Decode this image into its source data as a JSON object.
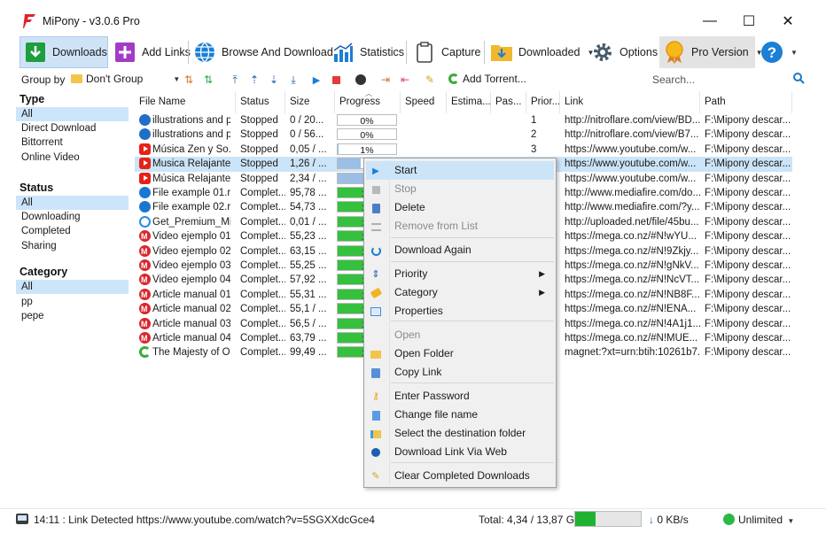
{
  "window": {
    "title": "MiPony - v3.0.6 Pro",
    "controls": {
      "minimize": "—",
      "maximize": "☐",
      "close": "✕"
    }
  },
  "toolbar": {
    "downloads": "Downloads",
    "add_links": "Add Links",
    "browse": "Browse And Download",
    "statistics": "Statistics",
    "capture": "Capture",
    "downloaded": "Downloaded",
    "options": "Options",
    "pro": "Pro Version",
    "help": "?"
  },
  "filter": {
    "group_by_label": "Group by",
    "group_value": "Don't Group",
    "add_torrent": "Add Torrent...",
    "search_placeholder": "Search..."
  },
  "sidebar": {
    "type_heading": "Type",
    "type_items": [
      "All",
      "Direct Download",
      "Bittorrent",
      "Online Video"
    ],
    "status_heading": "Status",
    "status_items": [
      "All",
      "Downloading",
      "Completed",
      "Sharing"
    ],
    "category_heading": "Category",
    "category_items": [
      "All",
      "pp",
      "pepe"
    ]
  },
  "table": {
    "columns": [
      "File Name",
      "Status",
      "Size",
      "Progress",
      "Speed",
      "Estima...",
      "Pas...",
      "Prior...",
      "Link",
      "Path"
    ],
    "rows": [
      {
        "icon": "blue",
        "name": "illustrations and p...",
        "status": "Stopped",
        "size": "0 / 20...",
        "progress": 0,
        "progress_text": "0%",
        "priority": "1",
        "link": "http://nitroflare.com/view/BD...",
        "path": "F:\\Mipony descar..."
      },
      {
        "icon": "blue",
        "name": "illustrations and p...",
        "status": "Stopped",
        "size": "0 / 56...",
        "progress": 0,
        "progress_text": "0%",
        "priority": "2",
        "link": "http://nitroflare.com/view/B7...",
        "path": "F:\\Mipony descar..."
      },
      {
        "icon": "yt",
        "name": "Música Zen y So...",
        "status": "Stopped",
        "size": "0,05 / ...",
        "progress": 1,
        "progress_text": "1%",
        "priority": "3",
        "link": "https://www.youtube.com/w...",
        "path": "F:\\Mipony descar..."
      },
      {
        "icon": "yt",
        "name": "Musica Relajante...",
        "status": "Stopped",
        "size": "1,26 / ...",
        "progress": 40,
        "progress_text": "2",
        "priority": "",
        "link": "https://www.youtube.com/w...",
        "path": "F:\\Mipony descar..."
      },
      {
        "icon": "yt",
        "name": "Música Relajante...",
        "status": "Stopped",
        "size": "2,34 / ...",
        "progress": 45,
        "progress_text": "7",
        "priority": "",
        "link": "https://www.youtube.com/w...",
        "path": "F:\\Mipony descar..."
      },
      {
        "icon": "mf",
        "name": "File example 01.rar",
        "status": "Complet...",
        "size": "95,78 ...",
        "progress": 100,
        "progress_text": "10",
        "priority": "",
        "link": "http://www.mediafire.com/do...",
        "path": "F:\\Mipony descar..."
      },
      {
        "icon": "mf",
        "name": "File example 02.rar",
        "status": "Complet...",
        "size": "54,73 ...",
        "progress": 100,
        "progress_text": "10",
        "priority": "",
        "link": "http://www.mediafire.com/?y...",
        "path": "F:\\Mipony descar..."
      },
      {
        "icon": "ul",
        "name": "Get_Premium_Mi...",
        "status": "Complet...",
        "size": "0,01 / ...",
        "progress": 100,
        "progress_text": "10",
        "priority": "",
        "link": "http://uploaded.net/file/45bu...",
        "path": "F:\\Mipony descar..."
      },
      {
        "icon": "mega",
        "name": "Video ejemplo 01...",
        "status": "Complet...",
        "size": "55,23 ...",
        "progress": 100,
        "progress_text": "10",
        "priority": "",
        "link": "https://mega.co.nz/#N!wYU...",
        "path": "F:\\Mipony descar..."
      },
      {
        "icon": "mega",
        "name": "Video ejemplo 02...",
        "status": "Complet...",
        "size": "63,15 ...",
        "progress": 100,
        "progress_text": "10",
        "priority": "",
        "link": "https://mega.co.nz/#N!9Zkjy...",
        "path": "F:\\Mipony descar..."
      },
      {
        "icon": "mega",
        "name": "Video ejemplo 03...",
        "status": "Complet...",
        "size": "55,25 ...",
        "progress": 100,
        "progress_text": "10",
        "priority": "",
        "link": "https://mega.co.nz/#N!gNkV...",
        "path": "F:\\Mipony descar..."
      },
      {
        "icon": "mega",
        "name": "Video ejemplo 04...",
        "status": "Complet...",
        "size": "57,92 ...",
        "progress": 100,
        "progress_text": "10",
        "priority": "",
        "link": "https://mega.co.nz/#N!NcVT...",
        "path": "F:\\Mipony descar..."
      },
      {
        "icon": "mega",
        "name": "Article manual 01...",
        "status": "Complet...",
        "size": "55,31 ...",
        "progress": 100,
        "progress_text": "10",
        "priority": "",
        "link": "https://mega.co.nz/#N!NB8F...",
        "path": "F:\\Mipony descar..."
      },
      {
        "icon": "mega",
        "name": "Article manual 02...",
        "status": "Complet...",
        "size": "55,1 / ...",
        "progress": 100,
        "progress_text": "10",
        "priority": "",
        "link": "https://mega.co.nz/#N!ENA...",
        "path": "F:\\Mipony descar..."
      },
      {
        "icon": "mega",
        "name": "Article manual 03...",
        "status": "Complet...",
        "size": "56,5 / ...",
        "progress": 100,
        "progress_text": "10",
        "priority": "",
        "link": "https://mega.co.nz/#N!4A1j1...",
        "path": "F:\\Mipony descar..."
      },
      {
        "icon": "mega",
        "name": "Article manual 04...",
        "status": "Complet...",
        "size": "63,79 ...",
        "progress": 100,
        "progress_text": "10",
        "priority": "",
        "link": "https://mega.co.nz/#N!MUE...",
        "path": "F:\\Mipony descar..."
      },
      {
        "icon": "torr",
        "name": "The Majesty of O...",
        "status": "Complet...",
        "size": "99,49 ...",
        "progress": 100,
        "progress_text": "10",
        "priority": "",
        "link": "magnet:?xt=urn:btih:10261b7...",
        "path": "F:\\Mipony descar..."
      }
    ]
  },
  "context_menu": {
    "items": [
      {
        "label": "Start",
        "icon": "play-icon",
        "disabled": false
      },
      {
        "label": "Stop",
        "icon": "stop-icon",
        "disabled": true
      },
      {
        "label": "Delete",
        "icon": "trash-icon",
        "disabled": false
      },
      {
        "label": "Remove from List",
        "icon": "list-remove-icon",
        "disabled": true
      },
      {
        "label": "Download Again",
        "icon": "refresh-icon",
        "disabled": false
      },
      {
        "label": "Priority",
        "icon": "priority-icon",
        "disabled": false
      },
      {
        "label": "Category",
        "icon": "tag-icon",
        "disabled": false
      },
      {
        "label": "Properties",
        "icon": "properties-icon",
        "disabled": false
      },
      {
        "label": "Open",
        "icon": "",
        "disabled": true
      },
      {
        "label": "Open Folder",
        "icon": "folder-icon",
        "disabled": false
      },
      {
        "label": "Copy Link",
        "icon": "copy-icon",
        "disabled": false
      },
      {
        "label": "Enter Password",
        "icon": "key-icon",
        "disabled": false
      },
      {
        "label": "Change file name",
        "icon": "rename-icon",
        "disabled": false
      },
      {
        "label": "Select the destination folder",
        "icon": "folder-open-icon",
        "disabled": false
      },
      {
        "label": "Download Link Via Web",
        "icon": "info-icon",
        "disabled": false
      },
      {
        "label": "Clear Completed Downloads",
        "icon": "broom-icon",
        "disabled": false
      }
    ]
  },
  "statusbar": {
    "message": "14:11 : Link Detected https://www.youtube.com/watch?v=5SGXXdcGce4",
    "total": "Total: 4,34 / 13,87 GB",
    "total_fraction": 0.31,
    "speed": "0 KB/s",
    "limit": "Unlimited"
  },
  "colors": {
    "selection": "#cce4f7",
    "progress_complete": "#35c13d",
    "progress_partial": "#9bbfe6",
    "mega_red": "#d9272e",
    "youtube_red": "#e62117"
  }
}
